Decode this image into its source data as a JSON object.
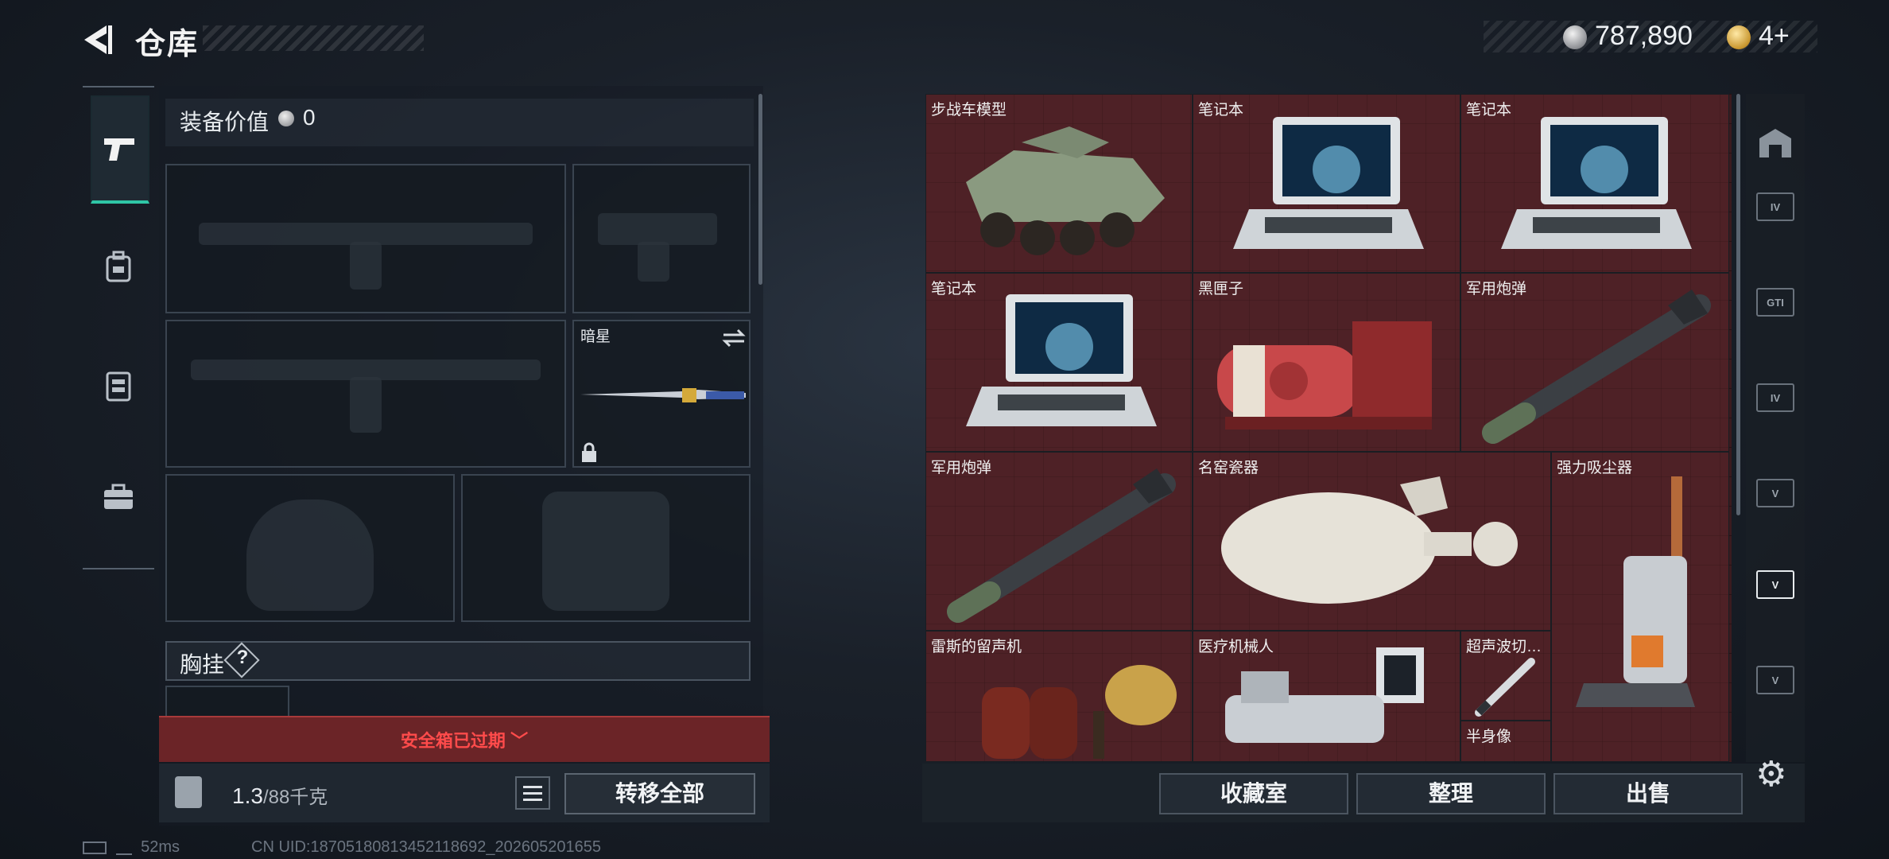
{
  "header": {
    "title": "仓库",
    "money": "787,890",
    "gold": "4+"
  },
  "equipment": {
    "value_label": "装备价值",
    "value": "0",
    "melee_name": "暗星",
    "chest_label": "胸挂",
    "help": "?",
    "safe_box_status": "安全箱已过期",
    "weight": "1.3",
    "weight_max": "/88千克",
    "transfer_all": "转移全部"
  },
  "inventory": {
    "items": [
      {
        "name": "步战车模型",
        "icon": "ifv-model-icon"
      },
      {
        "name": "笔记本",
        "icon": "laptop-icon"
      },
      {
        "name": "笔记本",
        "icon": "laptop-icon"
      },
      {
        "name": "笔记本",
        "icon": "laptop-icon"
      },
      {
        "name": "黑匣子",
        "icon": "black-box-icon"
      },
      {
        "name": "军用炮弹",
        "icon": "missile-icon"
      },
      {
        "name": "军用炮弹",
        "icon": "missile-icon"
      },
      {
        "name": "名窑瓷器",
        "icon": "porcelain-vase-icon"
      },
      {
        "name": "强力吸尘器",
        "icon": "vacuum-icon"
      },
      {
        "name": "雷斯的留声机",
        "icon": "gramophone-icon"
      },
      {
        "name": "医疗机械人",
        "icon": "medical-robot-icon"
      },
      {
        "name": "超声波切…",
        "icon": "ultrasonic-cutter-icon"
      },
      {
        "name": "半身像",
        "icon": "bust-icon"
      }
    ],
    "buttons": {
      "collection": "收藏室",
      "organize": "整理",
      "sell": "出售"
    },
    "filters": [
      "IV",
      "GTI",
      "IV",
      "V",
      "V",
      "V"
    ]
  },
  "status": {
    "ping": "52ms",
    "uid": "CN UID:18705180813452118692_202605201655"
  },
  "colors": {
    "accent": "#2fc6a6",
    "alert": "#ff4b4b",
    "grid_bg": "#5f262c"
  }
}
